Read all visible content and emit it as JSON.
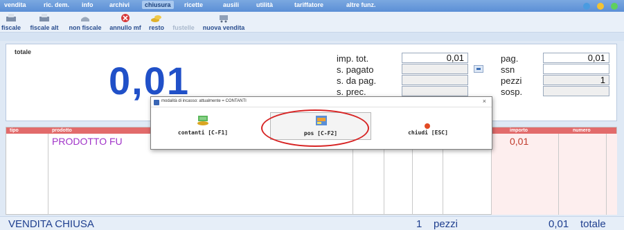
{
  "menu": [
    {
      "label": "vendita",
      "active": false
    },
    {
      "label": "ric. dem.",
      "active": false
    },
    {
      "label": "info",
      "active": false
    },
    {
      "label": "archivi",
      "active": false
    },
    {
      "label": "chiusura",
      "active": true
    },
    {
      "label": "ricette",
      "active": false
    },
    {
      "label": "ausili",
      "active": false
    },
    {
      "label": "utilità",
      "active": false
    },
    {
      "label": "tariffatore",
      "active": false
    },
    {
      "label": "altre funz.",
      "active": false
    }
  ],
  "window_buttons": [
    "minimize-dot",
    "maximize-dot",
    "restore-dot"
  ],
  "toolbar": [
    {
      "label": "fiscale",
      "icon": "printer-icon",
      "enabled": true
    },
    {
      "label": "fiscale alt",
      "icon": "printer-alt-icon",
      "enabled": true
    },
    {
      "label": "non fiscale",
      "icon": "receipt-icon",
      "enabled": true
    },
    {
      "label": "annullo mf",
      "icon": "cancel-icon",
      "enabled": true
    },
    {
      "label": "resto",
      "icon": "coins-icon",
      "enabled": true
    },
    {
      "label": "fustelle",
      "icon": "",
      "enabled": false
    },
    {
      "label": "nuova vendita",
      "icon": "cart-icon",
      "enabled": true
    }
  ],
  "totals_panel": {
    "caption": "totale",
    "big_total": "0,01",
    "fields": {
      "imp_tot_label": "imp. tot.",
      "imp_tot_value": "0,01",
      "s_pagato_label": "s. pagato",
      "s_pagato_value": "",
      "s_da_pag_label": "s. da pag.",
      "s_da_pag_value": "",
      "s_prec_label": "s. prec.",
      "s_prec_value": "",
      "pag_label": "pag.",
      "pag_value": "0,01",
      "ssn_label": "ssn",
      "ssn_value": "",
      "pezzi_label": "pezzi",
      "pezzi_value": "1",
      "sosp_label": "sosp.",
      "sosp_value": ""
    }
  },
  "grid": {
    "headers": {
      "tipo": "tipo",
      "prodotto": "prodotto",
      "importo": "importo",
      "numero": "numero"
    },
    "rows": [
      {
        "prodotto": "PRODOTTO FU",
        "importo": "0,01"
      }
    ]
  },
  "status": {
    "state": "VENDITA CHIUSA",
    "count": "1",
    "count_label": "pezzi",
    "total": "0,01",
    "total_label": "totale"
  },
  "dialog": {
    "title": "modalità di incasso: attualmente = CONTANTI",
    "close": "×",
    "buttons": [
      {
        "label": "contanti [C-F1]",
        "icon": "cash-icon"
      },
      {
        "label": "pos [C-F2]",
        "icon": "pos-card-icon"
      },
      {
        "label": "chiudi [ESC]",
        "icon": "close-dot-icon"
      }
    ]
  },
  "colors": {
    "menu_bar": "#5b8fd6",
    "big_total": "#2050c8",
    "grid_header": "#e26b6b",
    "highlight_ring": "#d72424"
  }
}
